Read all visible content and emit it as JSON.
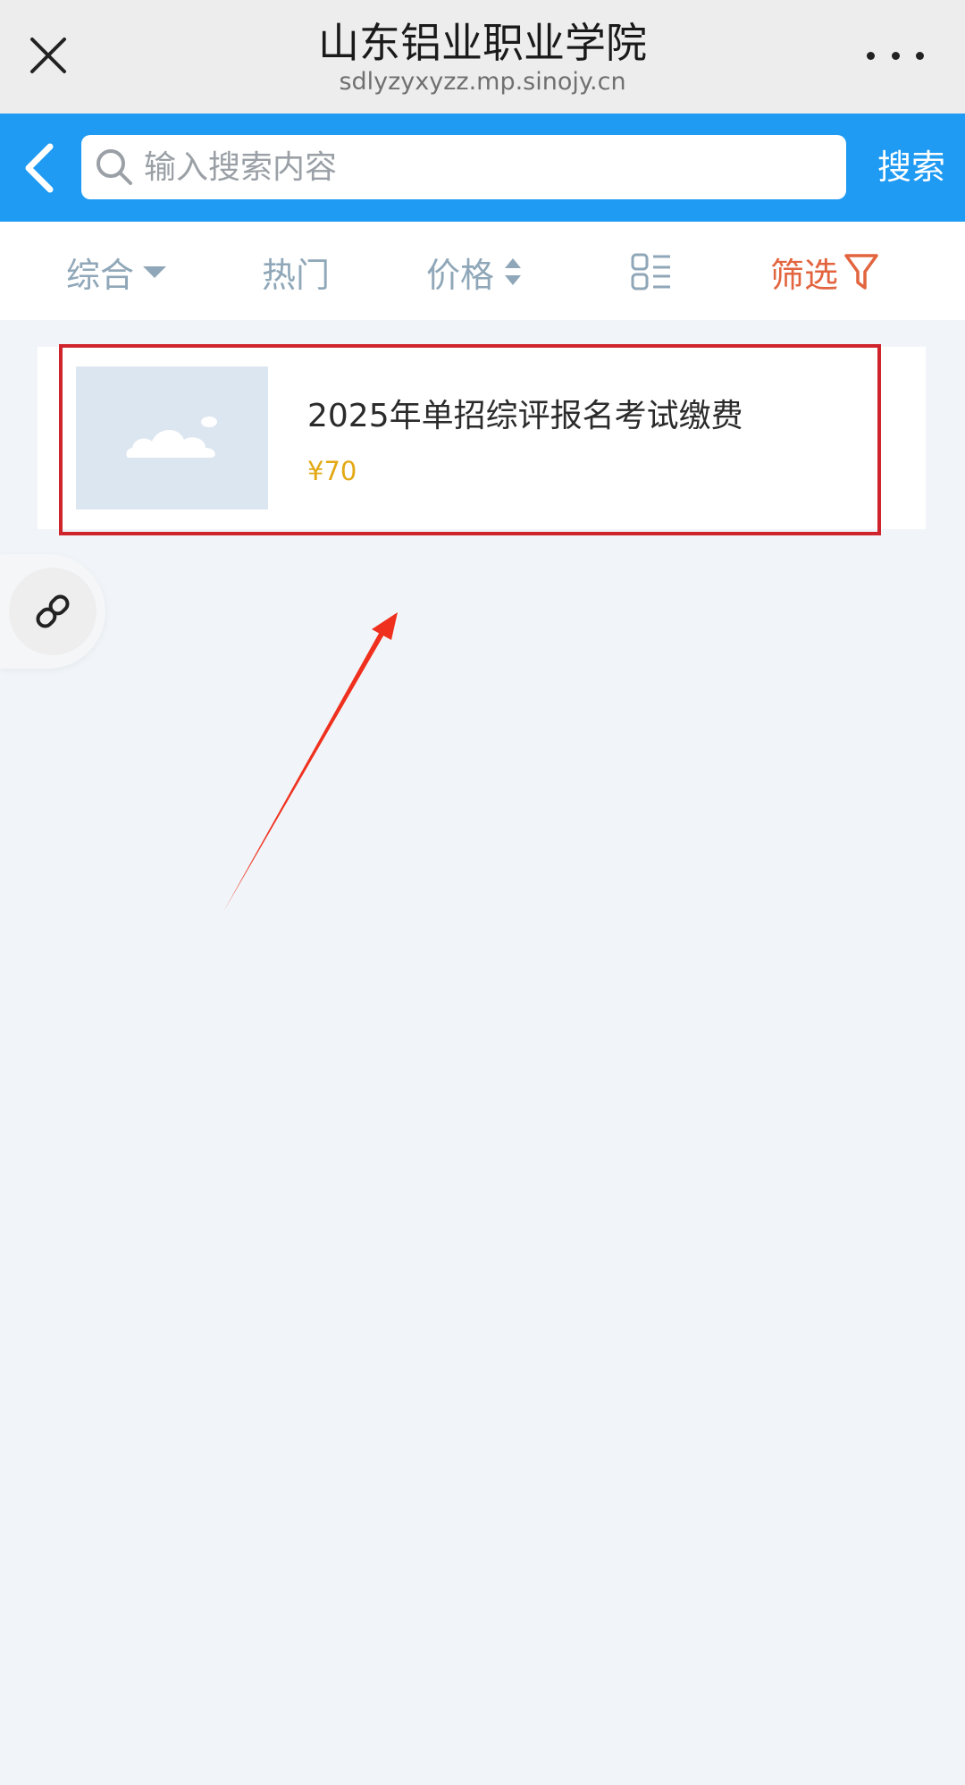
{
  "window": {
    "title": "山东铝业职业学院",
    "url": "sdlyzyxyzz.mp.sinojy.cn"
  },
  "search": {
    "placeholder": "输入搜索内容",
    "button_label": "搜索"
  },
  "filters": {
    "composite": "综合",
    "hot": "热门",
    "price": "价格",
    "filter": "筛选"
  },
  "products": [
    {
      "title": "2025年单招综评报名考试缴费",
      "price": "¥70"
    }
  ],
  "colors": {
    "header_blue": "#1f9bf3",
    "filter_text": "#8fa7b8",
    "filter_active": "#e2653f",
    "price": "#e3a813",
    "highlight_border": "#d0242c"
  },
  "icons": {
    "close": "close-icon",
    "more": "more-dots-icon",
    "back": "chevron-left-icon",
    "search": "search-icon",
    "layout": "list-layout-icon",
    "funnel": "funnel-icon",
    "link": "link-icon",
    "image_placeholder": "image-placeholder-icon"
  }
}
